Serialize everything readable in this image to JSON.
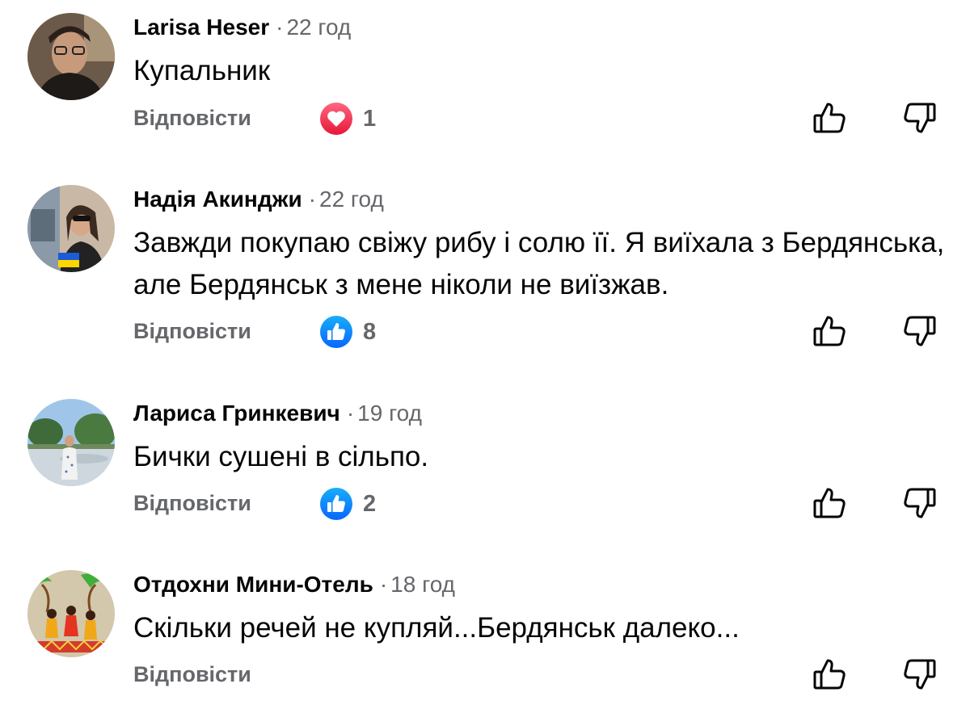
{
  "comments": [
    {
      "author": "Larisa Heser",
      "time": "22 год",
      "text": "Купальник",
      "reply_label": "Відповісти",
      "reaction": {
        "icon": "heart-icon",
        "color": "#f33e58",
        "count": "1"
      }
    },
    {
      "author": "Надія Акинджи",
      "time": "22 год",
      "text": "Завжди покупаю свіжу рибу і солю її. Я виїхала з Бердянська, але Бердянськ з мене ніколи не виїзжав.",
      "reply_label": "Відповісти",
      "reaction": {
        "icon": "thumbs-up-icon",
        "color": "#1877f2",
        "count": "8"
      }
    },
    {
      "author": "Лариса Гринкевич",
      "time": "19 год",
      "text": "Бички сушені в сільпо.",
      "reply_label": "Відповісти",
      "reaction": {
        "icon": "thumbs-up-icon",
        "color": "#1877f2",
        "count": "2"
      }
    },
    {
      "author": "Отдохни Мини-Отель",
      "time": "18 год",
      "text": "Скільки речей не купляй...Бердянськ далеко...",
      "reply_label": "Відповісти",
      "reaction": null
    }
  ],
  "separator": "·",
  "colors": {
    "secondary_text": "#65676b",
    "primary_text": "#050505",
    "like_blue": "#1877f2",
    "love_red": "#f33e58"
  }
}
